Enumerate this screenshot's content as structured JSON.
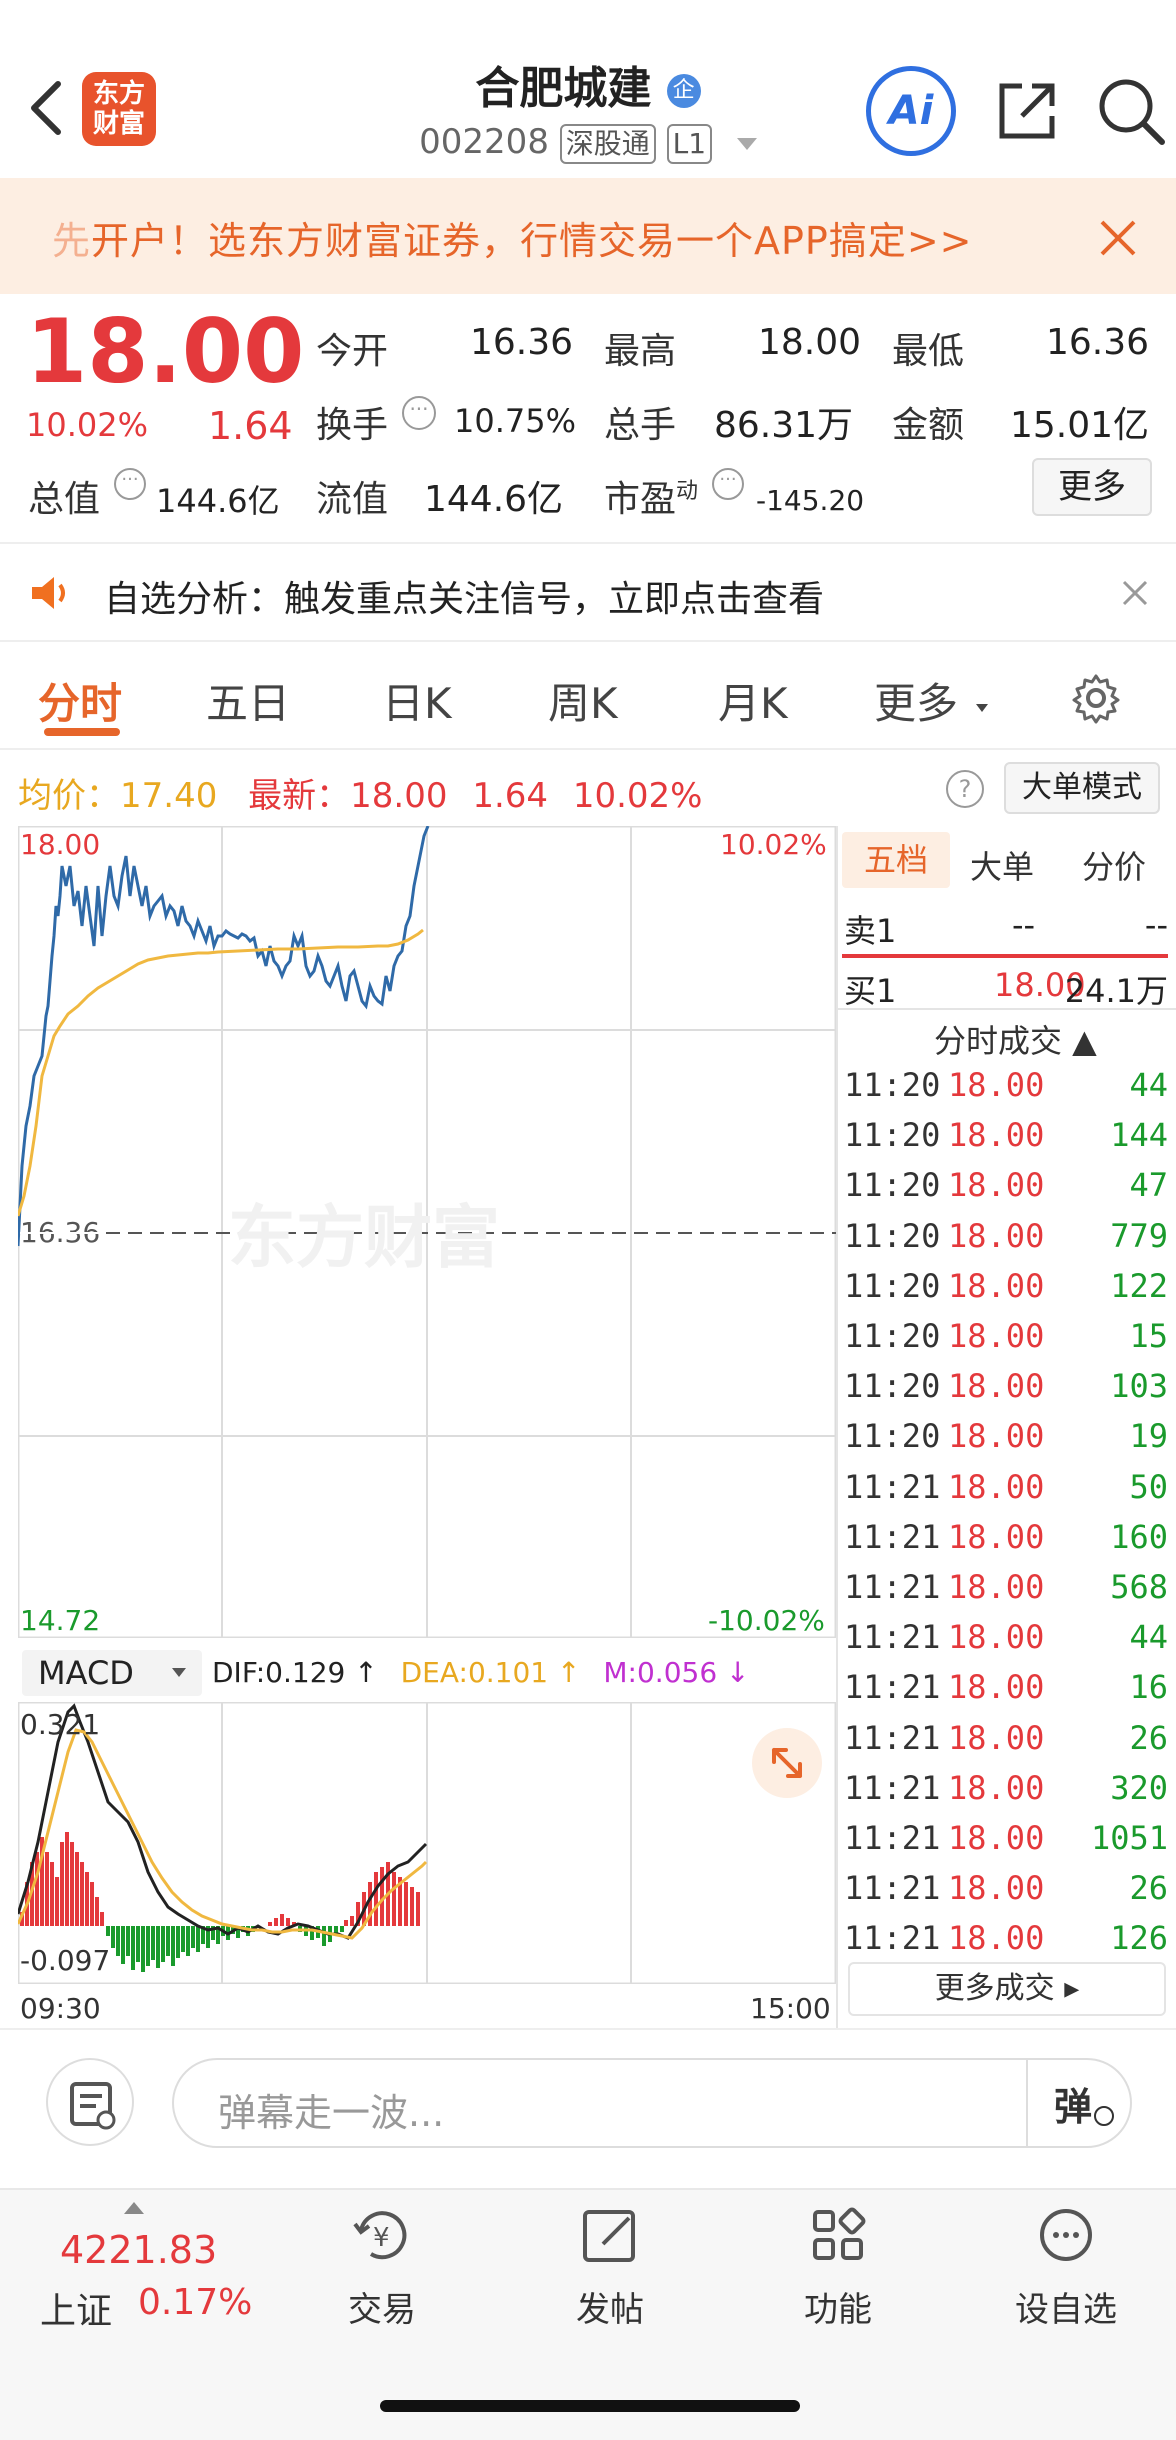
{
  "header": {
    "title": "合肥城建",
    "badge": "企",
    "code": "002208",
    "tag1": "深股通",
    "tag2": "L1",
    "logo_line1": "东方",
    "logo_line2": "财富",
    "ai_label": "Ai"
  },
  "banner": {
    "text_first": "先",
    "text_rest": "开户！选东方财富证券，行情交易一个APP搞定>>"
  },
  "quote": {
    "price": "18.00",
    "change_pct": "10.02%",
    "change": "1.64",
    "open_label": "今开",
    "open": "16.36",
    "high_label": "最高",
    "high": "18.00",
    "low_label": "最低",
    "low": "16.36",
    "turnover_label": "换手",
    "turnover": "10.75%",
    "volume_label": "总手",
    "volume": "86.31万",
    "amount_label": "金额",
    "amount": "15.01亿",
    "mktcap_label": "总值",
    "mktcap": "144.6亿",
    "float_label": "流值",
    "float": "144.6亿",
    "pe_label": "市盈",
    "pe_sup": "动",
    "pe": "-145.20",
    "more_label": "更多"
  },
  "notice": {
    "text": "自选分析：触发重点关注信号，立即点击查看"
  },
  "tabs": [
    "分时",
    "五日",
    "日K",
    "周K",
    "月K",
    "更多"
  ],
  "info_bar": {
    "avg_label": "均价：",
    "avg": "17.40",
    "latest_label": "最新：",
    "latest": "18.00",
    "latest_change": "1.64",
    "latest_pct": "10.02%",
    "mode_label": "大单模式"
  },
  "chart_labels": {
    "price_top": "18.00",
    "pct_top": "10.02%",
    "price_mid": "16.36",
    "price_bottom": "14.72",
    "pct_bottom": "-10.02%",
    "watermark": "东方财富",
    "time_start": "09:30",
    "time_end": "15:00"
  },
  "macd": {
    "selector": "MACD",
    "dif": "DIF:0.129 ↑",
    "dea": "DEA:0.101 ↑",
    "m": "M:0.056 ↓",
    "top": "0.321",
    "bottom": "-0.097"
  },
  "order_book": {
    "tabs": [
      "五档",
      "大单",
      "分价"
    ],
    "sell1_label": "卖1",
    "sell1_price": "--",
    "sell1_vol": "--",
    "buy1_label": "买1",
    "buy1_price": "18.00",
    "buy1_vol": "24.1万",
    "ticks_header": "分时成交 ▲",
    "more_ticks": "更多成交 ▸"
  },
  "ticks": [
    {
      "time": "11:20",
      "price": "18.00",
      "vol": "44"
    },
    {
      "time": "11:20",
      "price": "18.00",
      "vol": "144"
    },
    {
      "time": "11:20",
      "price": "18.00",
      "vol": "47"
    },
    {
      "time": "11:20",
      "price": "18.00",
      "vol": "779"
    },
    {
      "time": "11:20",
      "price": "18.00",
      "vol": "122"
    },
    {
      "time": "11:20",
      "price": "18.00",
      "vol": "15"
    },
    {
      "time": "11:20",
      "price": "18.00",
      "vol": "103"
    },
    {
      "time": "11:20",
      "price": "18.00",
      "vol": "19"
    },
    {
      "time": "11:21",
      "price": "18.00",
      "vol": "50"
    },
    {
      "time": "11:21",
      "price": "18.00",
      "vol": "160"
    },
    {
      "time": "11:21",
      "price": "18.00",
      "vol": "568"
    },
    {
      "time": "11:21",
      "price": "18.00",
      "vol": "44"
    },
    {
      "time": "11:21",
      "price": "18.00",
      "vol": "16"
    },
    {
      "time": "11:21",
      "price": "18.00",
      "vol": "26"
    },
    {
      "time": "11:21",
      "price": "18.00",
      "vol": "320"
    },
    {
      "time": "11:21",
      "price": "18.00",
      "vol": "1051"
    },
    {
      "time": "11:21",
      "price": "18.00",
      "vol": "26"
    },
    {
      "time": "11:21",
      "price": "18.00",
      "vol": "126"
    }
  ],
  "comment": {
    "placeholder": "弹幕走一波...",
    "danmu": "弹"
  },
  "bottom_nav": {
    "index_value": "4221.83",
    "index_name": "上证",
    "index_pct": "0.17%",
    "items": [
      "交易",
      "发帖",
      "功能",
      "设自选"
    ]
  }
}
